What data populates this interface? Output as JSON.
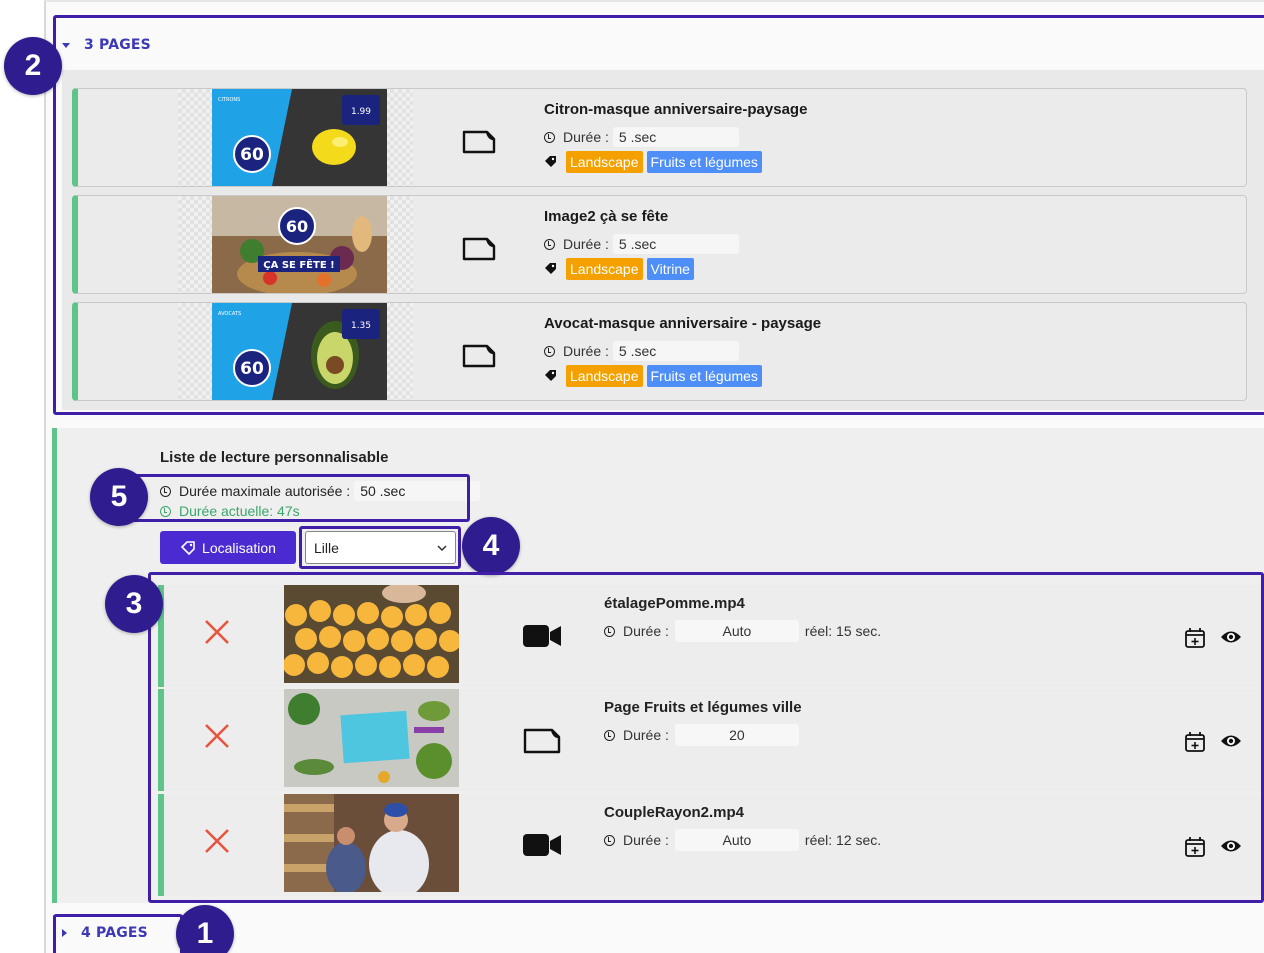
{
  "top_section": {
    "toggle_label": "3 PAGES",
    "pages": [
      {
        "title": "Citron-masque anniversaire-paysage",
        "duration_label": "Durée :",
        "duration_value": "5 .sec",
        "tags": [
          "Landscape",
          "Fruits et légumes"
        ]
      },
      {
        "title": "Image2 çà se fête",
        "duration_label": "Durée :",
        "duration_value": "5 .sec",
        "tags": [
          "Landscape",
          "Vitrine"
        ]
      },
      {
        "title": "Avocat-masque anniversaire - paysage",
        "duration_label": "Durée :",
        "duration_value": "5 .sec",
        "tags": [
          "Landscape",
          "Fruits et légumes"
        ]
      }
    ],
    "thumbs": [
      {
        "small_text": "CITRONS",
        "price": "1.99",
        "badge": "60"
      },
      {
        "line1": "60",
        "line2": "ÇA SE FÊTE !"
      },
      {
        "small_text": "AVOCATS",
        "price": "1.35",
        "badge": "60"
      }
    ]
  },
  "playlist": {
    "title": "Liste de lecture personnalisable",
    "max_duration_label": "Durée maximale autorisée :",
    "max_duration_value": "50 .sec",
    "current_duration": "Durée actuelle: 47s",
    "localisation_button": "Localisation",
    "location_select": "Lille",
    "items": [
      {
        "title": "étalagePomme.mp4",
        "duration_label": "Durée :",
        "duration_value": "Auto",
        "real": "réel: 15 sec.",
        "type": "video"
      },
      {
        "title": "Page Fruits et légumes ville",
        "duration_label": "Durée :",
        "duration_value": "20",
        "real": "",
        "type": "page"
      },
      {
        "title": "CoupleRayon2.mp4",
        "duration_label": "Durée :",
        "duration_value": "Auto",
        "real": "réel: 12 sec.",
        "type": "video"
      }
    ]
  },
  "bottom_section": {
    "toggle_label": "4 PAGES"
  },
  "badges": {
    "b1": "1",
    "b2": "2",
    "b3": "3",
    "b4": "4",
    "b5": "5"
  },
  "colors": {
    "accent": "#3d38b5",
    "highlight": "#3f1fa8",
    "badge": "#2f1d8f",
    "green_bar": "#5ec48a",
    "tag_orange": "#f4a100",
    "tag_blue": "#4e8ef7",
    "delete": "#e8553f"
  }
}
